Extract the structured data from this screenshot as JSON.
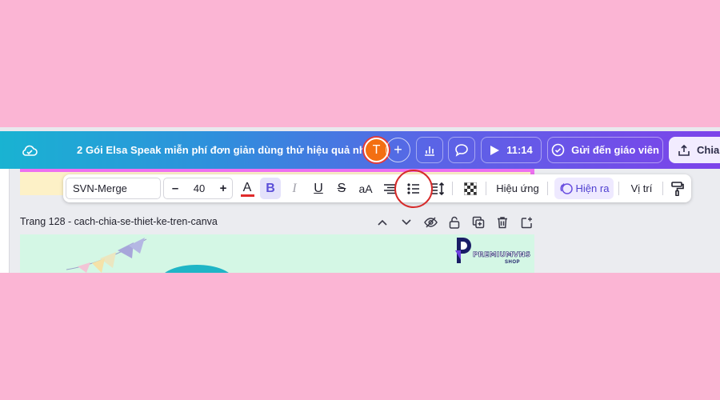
{
  "header": {
    "title": "2 Gói Elsa Speak miễn phí đơn giản dùng thử hiệu quả nhất",
    "avatar_initial": "T",
    "add_symbol": "+",
    "present_time": "11:14",
    "submit_label": "Gửi đến giáo viên",
    "share_label": "Chia s"
  },
  "toolbar": {
    "font_family": "SVN-Merge",
    "size_minus": "–",
    "font_size": "40",
    "size_plus": "+",
    "text_color_glyph": "A",
    "text_color": "#e02a2a",
    "bold_glyph": "B",
    "italic_glyph": "I",
    "underline_glyph": "U",
    "strike_glyph": "S",
    "case_glyph": "aA",
    "effects_label": "Hiệu ứng",
    "animate_label": "Hiện ra",
    "position_label": "Vị trí"
  },
  "page": {
    "title": "Trang 128 - cach-chia-se-thiet-ke-tren-canva"
  },
  "logo": {
    "main": "PREMIUMVNS",
    "sub": "SHOP"
  },
  "colors": {
    "background": "#fbb5d4",
    "accent_purple": "#7d43ea",
    "highlight_red": "#d62a2a"
  }
}
